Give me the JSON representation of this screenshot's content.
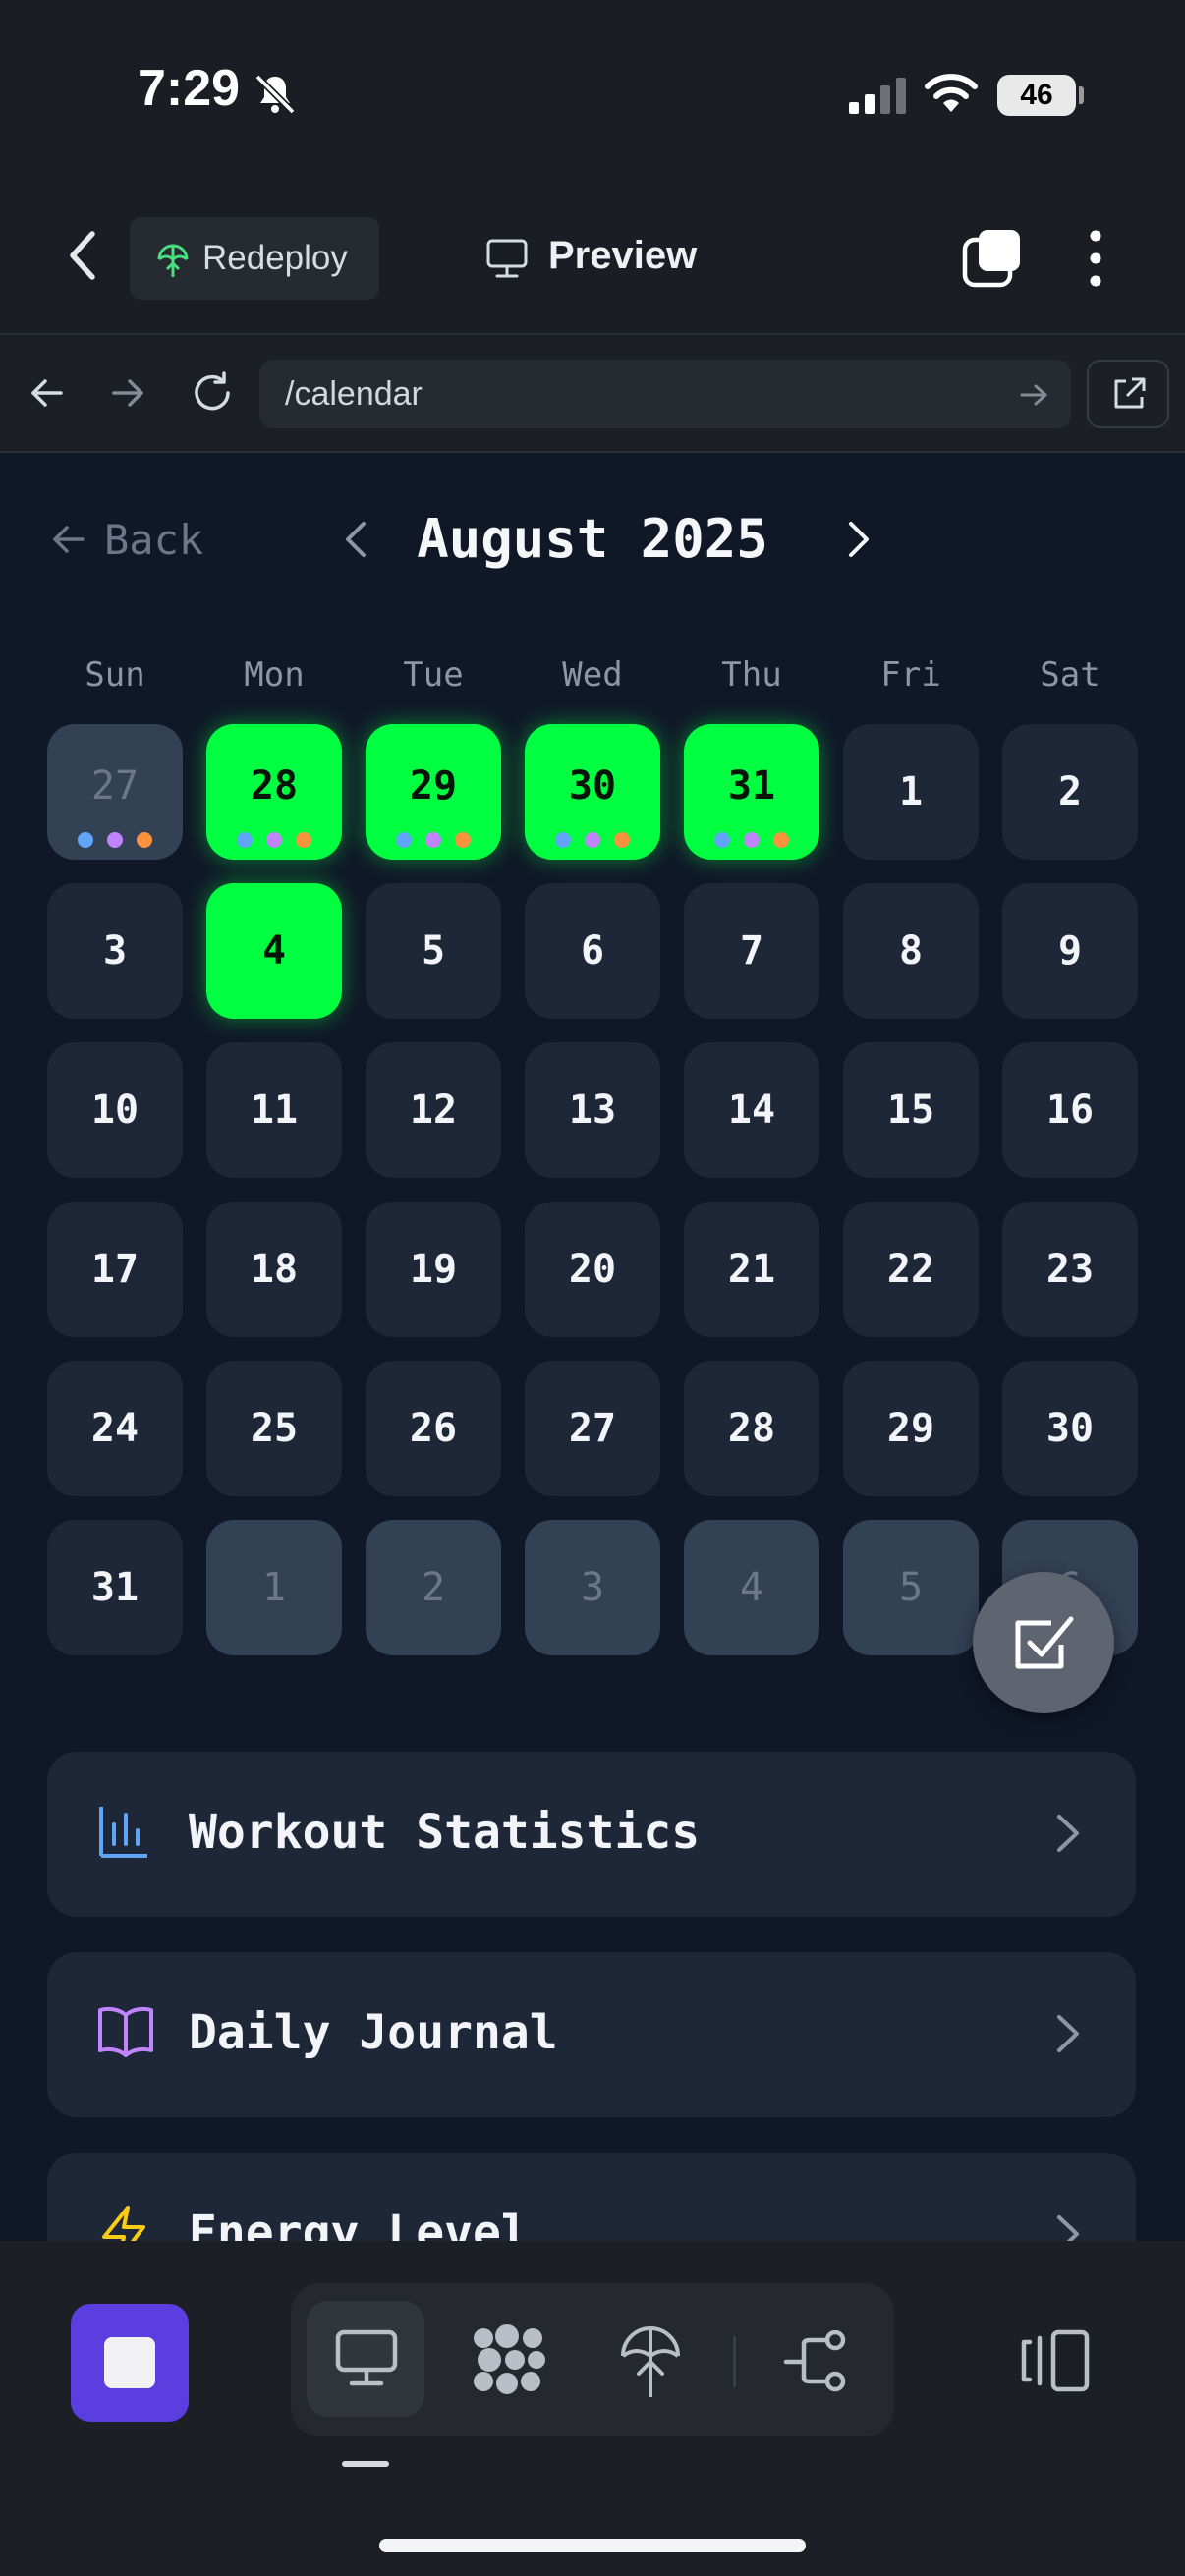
{
  "status_bar": {
    "time": "7:29",
    "battery": "46"
  },
  "app_bar": {
    "redeploy_label": "Redeploy",
    "preview_label": "Preview"
  },
  "browser": {
    "url": "/calendar"
  },
  "calendar": {
    "back_label": "Back",
    "month_title": "August 2025",
    "weekdays": [
      "Sun",
      "Mon",
      "Tue",
      "Wed",
      "Thu",
      "Fri",
      "Sat"
    ],
    "weeks": [
      [
        {
          "d": "27",
          "state": "muted",
          "dots": true
        },
        {
          "d": "28",
          "state": "active",
          "dots": true
        },
        {
          "d": "29",
          "state": "active",
          "dots": true
        },
        {
          "d": "30",
          "state": "active",
          "dots": true
        },
        {
          "d": "31",
          "state": "active",
          "dots": true
        },
        {
          "d": "1",
          "state": "normal"
        },
        {
          "d": "2",
          "state": "normal"
        }
      ],
      [
        {
          "d": "3",
          "state": "normal"
        },
        {
          "d": "4",
          "state": "active"
        },
        {
          "d": "5",
          "state": "normal"
        },
        {
          "d": "6",
          "state": "normal"
        },
        {
          "d": "7",
          "state": "normal"
        },
        {
          "d": "8",
          "state": "normal"
        },
        {
          "d": "9",
          "state": "normal"
        }
      ],
      [
        {
          "d": "10",
          "state": "normal"
        },
        {
          "d": "11",
          "state": "normal"
        },
        {
          "d": "12",
          "state": "normal"
        },
        {
          "d": "13",
          "state": "normal"
        },
        {
          "d": "14",
          "state": "normal"
        },
        {
          "d": "15",
          "state": "normal"
        },
        {
          "d": "16",
          "state": "normal"
        }
      ],
      [
        {
          "d": "17",
          "state": "normal"
        },
        {
          "d": "18",
          "state": "normal"
        },
        {
          "d": "19",
          "state": "normal"
        },
        {
          "d": "20",
          "state": "normal"
        },
        {
          "d": "21",
          "state": "normal"
        },
        {
          "d": "22",
          "state": "normal"
        },
        {
          "d": "23",
          "state": "normal"
        }
      ],
      [
        {
          "d": "24",
          "state": "normal"
        },
        {
          "d": "25",
          "state": "normal"
        },
        {
          "d": "26",
          "state": "normal"
        },
        {
          "d": "27",
          "state": "normal"
        },
        {
          "d": "28",
          "state": "normal"
        },
        {
          "d": "29",
          "state": "normal"
        },
        {
          "d": "30",
          "state": "normal"
        }
      ],
      [
        {
          "d": "31",
          "state": "normal"
        },
        {
          "d": "1",
          "state": "muted"
        },
        {
          "d": "2",
          "state": "muted"
        },
        {
          "d": "3",
          "state": "muted"
        },
        {
          "d": "4",
          "state": "muted"
        },
        {
          "d": "5",
          "state": "muted"
        },
        {
          "d": "6",
          "state": "muted"
        }
      ]
    ],
    "dot_colors": [
      "#60a5fa",
      "#c084fc",
      "#fb923c"
    ]
  },
  "menu_cards": [
    {
      "title": "Workout Statistics",
      "icon": "bar-chart-icon",
      "color": "#60a5fa"
    },
    {
      "title": "Daily Journal",
      "icon": "book-open-icon",
      "color": "#c084fc"
    },
    {
      "title": "Energy Level",
      "icon": "lightning-icon",
      "color": "#facc15"
    }
  ],
  "colors": {
    "active_day": "#00ff41",
    "run_button": "#5b3ee0",
    "page_bg": "#101828"
  }
}
